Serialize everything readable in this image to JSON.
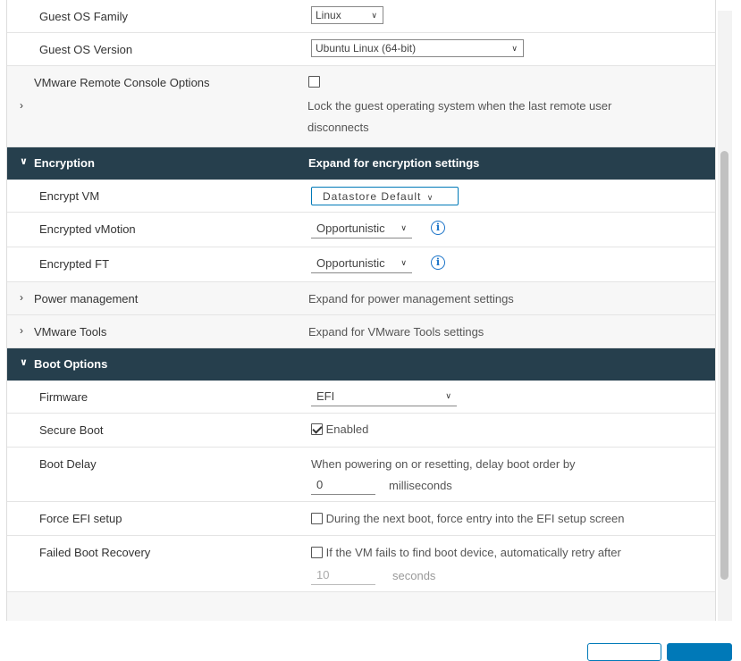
{
  "rows": {
    "guest_os_family": {
      "label": "Guest OS Family",
      "value": "Linux"
    },
    "guest_os_version": {
      "label": "Guest OS Version",
      "value": "Ubuntu Linux (64-bit)"
    },
    "vmrc": {
      "label": "VMware Remote Console Options",
      "checkbox_text": "Lock the guest operating system when the last remote user disconnects",
      "checked": false
    }
  },
  "encryption": {
    "title": "Encryption",
    "hint": "Expand for encryption settings",
    "encrypt_vm": {
      "label": "Encrypt VM",
      "value": "Datastore Default"
    },
    "encrypted_vmotion": {
      "label": "Encrypted vMotion",
      "value": "Opportunistic"
    },
    "encrypted_ft": {
      "label": "Encrypted FT",
      "value": "Opportunistic"
    }
  },
  "power_management": {
    "title": "Power management",
    "hint": "Expand for power management settings"
  },
  "vmware_tools": {
    "title": "VMware Tools",
    "hint": "Expand for VMware Tools settings"
  },
  "boot_options": {
    "title": "Boot Options",
    "firmware": {
      "label": "Firmware",
      "value": "EFI"
    },
    "secure_boot": {
      "label": "Secure Boot",
      "checkbox_text": "Enabled",
      "checked": true
    },
    "boot_delay": {
      "label": "Boot Delay",
      "description": "When powering on or resetting, delay boot order by",
      "value": "0",
      "unit": "milliseconds"
    },
    "force_efi": {
      "label": "Force EFI setup",
      "checkbox_text": "During the next boot, force entry into the EFI setup screen",
      "checked": false
    },
    "failed_boot": {
      "label": "Failed Boot Recovery",
      "checkbox_text": "If the VM fails to find boot device, automatically retry after",
      "checked": false,
      "value": "10",
      "unit": "seconds"
    }
  },
  "icons": {
    "expand": "chevron-right-icon",
    "collapse": "chevron-down-icon",
    "info": "info-icon"
  },
  "colors": {
    "section_header": "#263f4d",
    "accent": "#0079b8",
    "info": "#1a73c8"
  }
}
